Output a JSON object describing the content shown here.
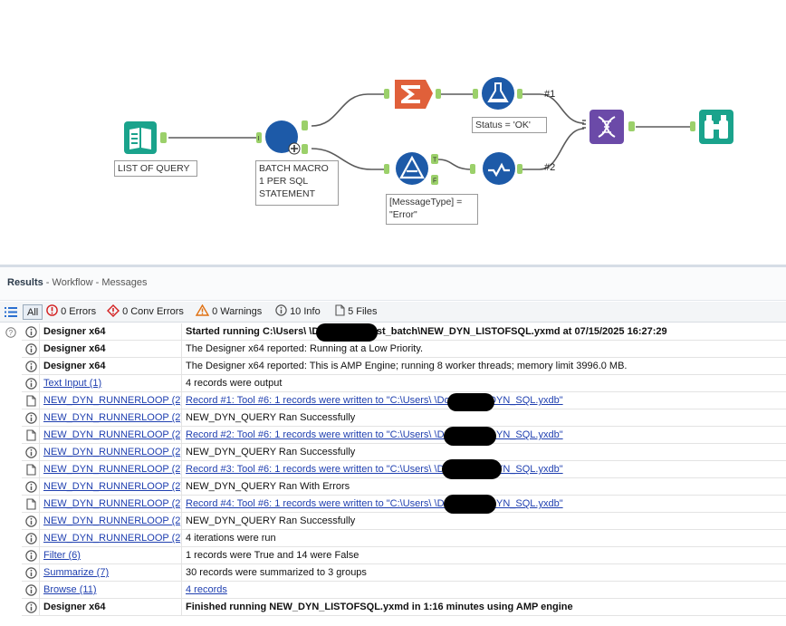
{
  "canvas": {
    "annotations": {
      "input": "LIST OF QUERY",
      "macro": [
        "BATCH MACRO",
        "1 PER SQL",
        "STATEMENT"
      ],
      "test": "Status = 'OK'",
      "filter": [
        "[MessageType] =",
        "\"Error\""
      ]
    },
    "wire_labels": {
      "one": "#1",
      "two": "#2"
    },
    "anchors": {
      "macro_in": "I",
      "filter_true": "T",
      "filter_false": "F"
    },
    "colors": {
      "input_tool": "#1aa38c",
      "macro_tool": "#1d5aa8",
      "summarize_tool": "#e0603a",
      "test_tool": "#1d5aa8",
      "filter_tool": "#1d5aa8",
      "union_tool": "#6b4aa8",
      "browse_tool": "#1aa38c",
      "anchor": "#9bd06a"
    }
  },
  "results": {
    "title": "Results",
    "breadcrumb": " - Workflow - Messages",
    "filters": {
      "all": "All",
      "errors": "0 Errors",
      "conv_errors": "0 Conv Errors",
      "warnings": "0 Warnings",
      "info": "10 Info",
      "files": "5 Files"
    },
    "rows": [
      {
        "icon": "info",
        "tool": "Designer x64",
        "tool_style": "bold",
        "msg": "Started running C:\\Users\\            \\Downloads\\test_batch\\NEW_DYN_LISTOFSQL.yxmd at 07/15/2025 16:27:29",
        "msg_style": "bold"
      },
      {
        "icon": "info",
        "tool": "Designer x64",
        "tool_style": "bold",
        "msg": "The Designer x64 reported: Running at a Low Priority.",
        "msg_style": "plain"
      },
      {
        "icon": "info",
        "tool": "Designer x64",
        "tool_style": "bold",
        "msg": "The Designer x64 reported: This is AMP Engine; running 8 worker threads; memory limit 3996.0 MB.",
        "msg_style": "plain"
      },
      {
        "icon": "info",
        "tool": "Text Input (1)",
        "tool_style": "link",
        "msg": "4 records were output",
        "msg_style": "plain"
      },
      {
        "icon": "file",
        "tool": "NEW_DYN_RUNNERLOOP (2)",
        "tool_style": "link",
        "msg": "Record #1: Tool #6: 1 records were written to \"C:\\Users\\            \\Downloads\\DYN_SQL.yxdb\"",
        "msg_style": "link"
      },
      {
        "icon": "info",
        "tool": "NEW_DYN_RUNNERLOOP (2)",
        "tool_style": "link",
        "msg": "NEW_DYN_QUERY Ran Successfully",
        "msg_style": "plain"
      },
      {
        "icon": "file",
        "tool": "NEW_DYN_RUNNERLOOP (2)",
        "tool_style": "link",
        "msg": "Record #2: Tool #6: 1 records were written to \"C:\\Users\\            \\Downloads\\DYN_SQL.yxdb\"",
        "msg_style": "link"
      },
      {
        "icon": "info",
        "tool": "NEW_DYN_RUNNERLOOP (2)",
        "tool_style": "link",
        "msg": "NEW_DYN_QUERY Ran Successfully",
        "msg_style": "plain"
      },
      {
        "icon": "file",
        "tool": "NEW_DYN_RUNNERLOOP (2)",
        "tool_style": "link",
        "msg": "Record #3: Tool #6: 1 records were written to \"C:\\Users\\            \\Downloads\\DYN_SQL.yxdb\"",
        "msg_style": "link"
      },
      {
        "icon": "info",
        "tool": "NEW_DYN_RUNNERLOOP (2)",
        "tool_style": "link",
        "msg": "NEW_DYN_QUERY Ran With Errors",
        "msg_style": "plain"
      },
      {
        "icon": "file",
        "tool": "NEW_DYN_RUNNERLOOP (2)",
        "tool_style": "link",
        "msg": "Record #4: Tool #6: 1 records were written to \"C:\\Users\\            \\Downloads\\DYN_SQL.yxdb\"",
        "msg_style": "link"
      },
      {
        "icon": "info",
        "tool": "NEW_DYN_RUNNERLOOP (2)",
        "tool_style": "link",
        "msg": "NEW_DYN_QUERY Ran Successfully",
        "msg_style": "plain"
      },
      {
        "icon": "info",
        "tool": "NEW_DYN_RUNNERLOOP (2)",
        "tool_style": "link",
        "msg": "4 iterations were run",
        "msg_style": "plain"
      },
      {
        "icon": "info",
        "tool": "Filter (6)",
        "tool_style": "link",
        "msg": "1 records were True and 14 were False",
        "msg_style": "plain"
      },
      {
        "icon": "info",
        "tool": "Summarize (7)",
        "tool_style": "link",
        "msg": "30 records were summarized to 3 groups",
        "msg_style": "plain"
      },
      {
        "icon": "info",
        "tool": "Browse (11)",
        "tool_style": "link",
        "msg": "4 records",
        "msg_style": "link"
      },
      {
        "icon": "info",
        "tool": "Designer x64",
        "tool_style": "bold",
        "msg": "Finished running NEW_DYN_LISTOFSQL.yxmd in 1:16 minutes using AMP engine",
        "msg_style": "bold"
      }
    ]
  }
}
